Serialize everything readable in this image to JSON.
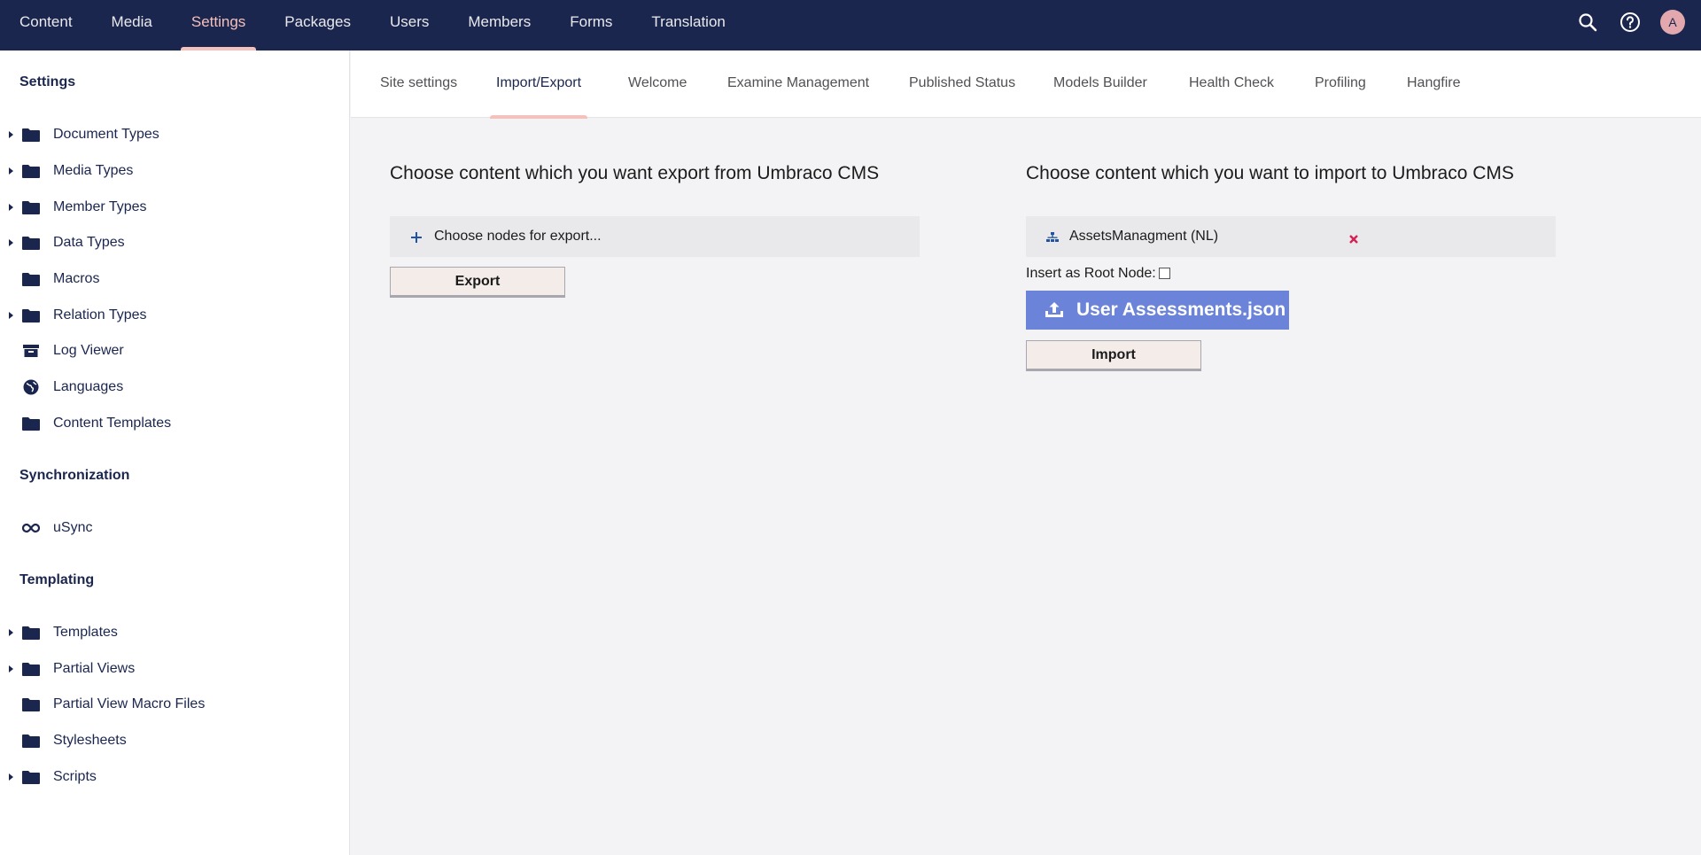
{
  "topnav": {
    "items": [
      {
        "label": "Content"
      },
      {
        "label": "Media"
      },
      {
        "label": "Settings"
      },
      {
        "label": "Packages"
      },
      {
        "label": "Users"
      },
      {
        "label": "Members"
      },
      {
        "label": "Forms"
      },
      {
        "label": "Translation"
      }
    ],
    "active_index": 2,
    "tools": {
      "search_icon": "search-icon",
      "help_icon": "help-icon",
      "avatar_initial": "A"
    }
  },
  "sidebar": {
    "settings_title": "Settings",
    "settings_items": [
      {
        "label": "Document Types",
        "icon": "folder-icon",
        "expandable": true
      },
      {
        "label": "Media Types",
        "icon": "folder-icon",
        "expandable": true
      },
      {
        "label": "Member Types",
        "icon": "folder-icon",
        "expandable": true
      },
      {
        "label": "Data Types",
        "icon": "folder-icon",
        "expandable": true
      },
      {
        "label": "Macros",
        "icon": "folder-icon",
        "expandable": false
      },
      {
        "label": "Relation Types",
        "icon": "folder-icon",
        "expandable": true
      },
      {
        "label": "Log Viewer",
        "icon": "archive-box-icon",
        "expandable": false
      },
      {
        "label": "Languages",
        "icon": "globe-icon",
        "expandable": false
      },
      {
        "label": "Content Templates",
        "icon": "folder-icon",
        "expandable": false
      }
    ],
    "sync_title": "Synchronization",
    "sync_items": [
      {
        "label": "uSync",
        "icon": "infinity-icon",
        "expandable": false
      }
    ],
    "templating_title": "Templating",
    "templating_items": [
      {
        "label": "Templates",
        "icon": "folder-icon",
        "expandable": true
      },
      {
        "label": "Partial Views",
        "icon": "folder-icon",
        "expandable": true
      },
      {
        "label": "Partial View Macro Files",
        "icon": "folder-icon",
        "expandable": false
      },
      {
        "label": "Stylesheets",
        "icon": "folder-icon",
        "expandable": false
      },
      {
        "label": "Scripts",
        "icon": "folder-icon",
        "expandable": true
      }
    ]
  },
  "subtabs": {
    "items": [
      {
        "label": "Site settings"
      },
      {
        "label": "Import/Export"
      },
      {
        "label": "Welcome"
      },
      {
        "label": "Examine Management"
      },
      {
        "label": "Published Status"
      },
      {
        "label": "Models Builder"
      },
      {
        "label": "Health Check"
      },
      {
        "label": "Profiling"
      },
      {
        "label": "Hangfire"
      }
    ],
    "active_index": 1
  },
  "export_panel": {
    "heading": "Choose content which you want export from Umbraco CMS",
    "picker_label": "Choose nodes for export...",
    "export_button": "Export"
  },
  "import_panel": {
    "heading": "Choose content which you want to import to Umbraco CMS",
    "selected_node": "AssetsManagment (NL)",
    "root_node_label": "Insert as Root Node:",
    "root_node_checked": false,
    "upload_file_name": "User Assessments.json",
    "import_button": "Import"
  },
  "colors": {
    "nav_bg": "#1b264f",
    "active_accent": "#f5c1bc",
    "upload_bg": "#6b84d9",
    "remove_red": "#d42054",
    "plus_blue": "#2152a3"
  }
}
